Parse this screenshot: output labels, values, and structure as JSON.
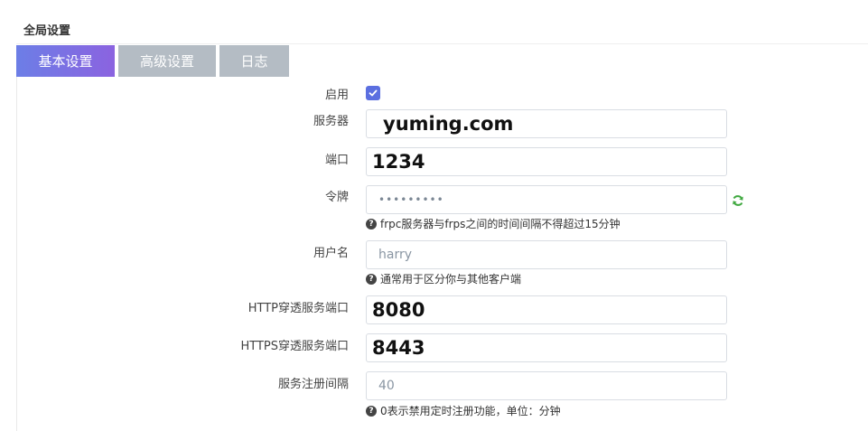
{
  "section": {
    "title": "全局设置"
  },
  "tabs": [
    {
      "label": "基本设置",
      "active": true
    },
    {
      "label": "高级设置",
      "active": false
    },
    {
      "label": "日志",
      "active": false
    }
  ],
  "form": {
    "enable": {
      "label": "启用",
      "checked": true
    },
    "server": {
      "label": "服务器",
      "value": "yuming.com"
    },
    "port": {
      "label": "端口",
      "value": "1234"
    },
    "token": {
      "label": "令牌",
      "value": "•••••••••",
      "hint": "frpc服务器与frps之间的时间间隔不得超过15分钟"
    },
    "username": {
      "label": "用户名",
      "value": "harry",
      "hint": "通常用于区分你与其他客户端"
    },
    "http_port": {
      "label": "HTTP穿透服务端口",
      "value": "8080"
    },
    "https_port": {
      "label": "HTTPS穿透服务端口",
      "value": "8443"
    },
    "register_interval": {
      "label": "服务注册间隔",
      "value": "40",
      "hint": "0表示禁用定时注册功能，单位：分钟"
    }
  },
  "colors": {
    "accent": "#6c7ee6",
    "accent_end": "#8b63e0",
    "inactive_tab": "#b4bcc4",
    "refresh_icon": "#3fa83f"
  },
  "icons": {
    "checkbox": "check-icon",
    "hint": "question-circle-icon",
    "token_action": "refresh-icon"
  }
}
